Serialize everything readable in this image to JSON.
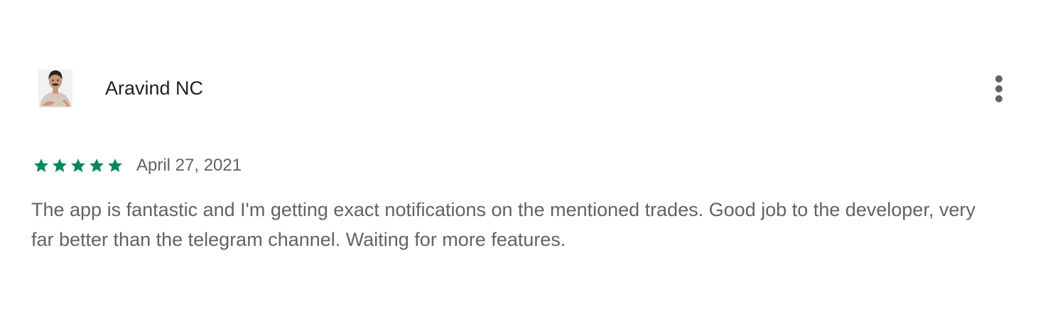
{
  "review": {
    "author_name": "Aravind NC",
    "avatar_icon": "user-avatar-illustration",
    "more_icon": "more-vertical-icon",
    "rating": 5,
    "rating_max": 5,
    "star_color": "#01875f",
    "date": "April 27, 2021",
    "text": "The app is fantastic and I'm getting exact notifications on the mentioned trades. Good job to the developer, very far better than the telegram channel. Waiting for more features."
  }
}
